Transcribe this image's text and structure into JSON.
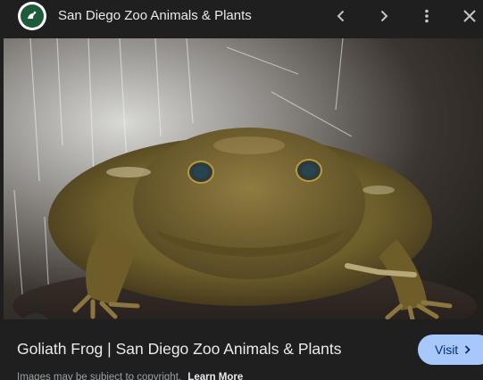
{
  "header": {
    "site_name": "San Diego Zoo Animals & Plants"
  },
  "result": {
    "title": "Goliath Frog | San Diego Zoo Animals & Plants",
    "visit_label": "Visit",
    "copyright_text": "Images may be subject to copyright.",
    "learn_more_label": "Learn More"
  },
  "colors": {
    "background": "#1f1f1f",
    "text": "#e8eaed",
    "visit_button": "#a8c7fa",
    "muted_text": "#9aa0a6"
  },
  "icons": {
    "site_logo": "san-diego-zoo-logo",
    "prev": "chevron-left-icon",
    "next": "chevron-right-icon",
    "more": "more-vert-icon",
    "close": "close-icon",
    "lens": "google-lens-icon",
    "visit": "chevron-right-icon"
  }
}
